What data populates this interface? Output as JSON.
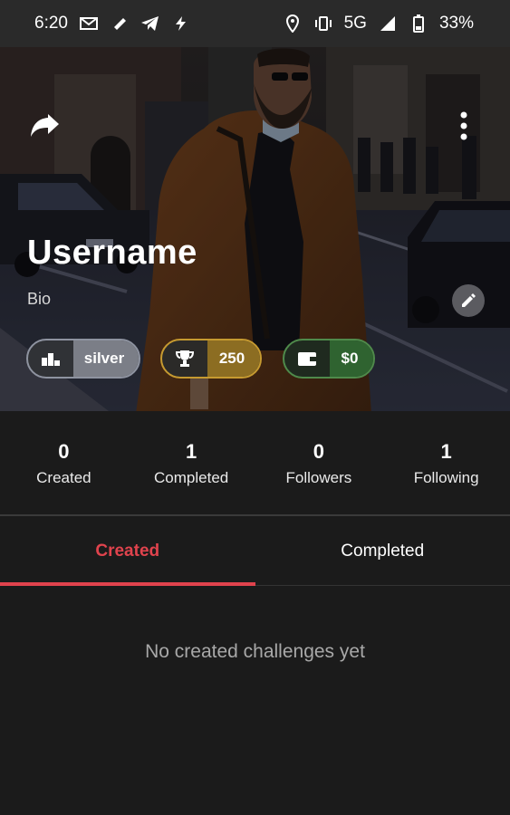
{
  "status_bar": {
    "time": "6:20",
    "network": "5G",
    "battery": "33%",
    "left_icons": [
      "gmail-icon",
      "ticket-icon",
      "telegram-icon",
      "bolt-icon"
    ],
    "right_icons": [
      "location-icon",
      "vibrate-icon",
      "signal-icon",
      "battery-icon"
    ]
  },
  "profile": {
    "username": "Username",
    "bio": "Bio",
    "badges": {
      "rank": "silver",
      "trophies": "250",
      "wallet": "$0"
    }
  },
  "stats": [
    {
      "value": "0",
      "label": "Created"
    },
    {
      "value": "1",
      "label": "Completed"
    },
    {
      "value": "0",
      "label": "Followers"
    },
    {
      "value": "1",
      "label": "Following"
    }
  ],
  "tabs": [
    {
      "label": "Created",
      "active": true
    },
    {
      "label": "Completed",
      "active": false
    }
  ],
  "empty_state": "No created challenges yet",
  "colors": {
    "accent": "#e0434d",
    "background": "#1b1b1b",
    "silver": "#7b7e87",
    "gold": "#c69a30",
    "green": "#2f6330"
  }
}
